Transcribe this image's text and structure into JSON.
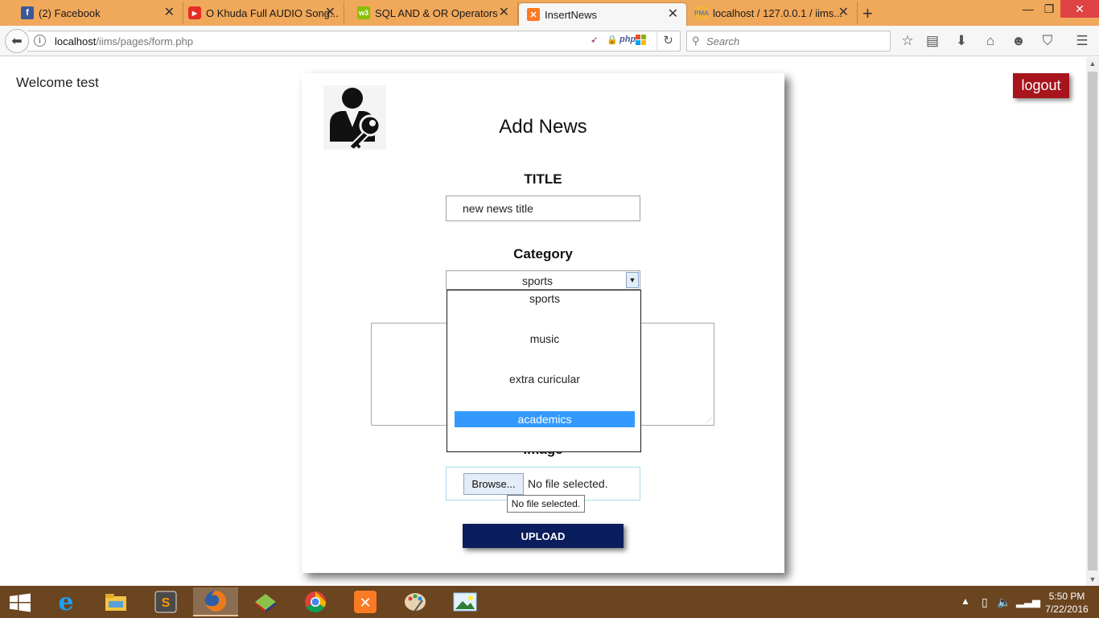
{
  "browser": {
    "tabs": [
      {
        "label": "(2) Facebook",
        "icon": "facebook-icon",
        "close": "✕"
      },
      {
        "label": "O Khuda Full AUDIO Song...",
        "icon": "youtube-icon",
        "close": "✕"
      },
      {
        "label": "SQL AND & OR Operators",
        "icon": "w3schools-icon",
        "close": "✕"
      },
      {
        "label": "InsertNews",
        "icon": "xampp-icon",
        "close": "✕",
        "active": true
      },
      {
        "label": "localhost / 127.0.0.1 / iims...",
        "icon": "phpmyadmin-icon",
        "close": "✕"
      }
    ],
    "new_tab": "+",
    "window_controls": {
      "minimize": "—",
      "maximize": "❐",
      "close": "✕"
    },
    "url": {
      "host": "localhost",
      "path": "/iims/pages/form.php"
    },
    "extension_php": "php",
    "search_placeholder": "Search"
  },
  "page": {
    "welcome": "Welcome test",
    "logout_label": "logout",
    "form": {
      "title": "Add News",
      "title_label": "TITLE",
      "title_value": "new news title",
      "category_label": "Category",
      "category_value": "sports",
      "category_options": [
        "sports",
        "music",
        "extra curicular",
        "academics"
      ],
      "highlighted_option": "academics",
      "image_label": "Image",
      "browse_label": "Browse...",
      "file_status": "No file selected.",
      "file_tooltip": "No file selected.",
      "upload_label": "UPLOAD"
    }
  },
  "taskbar": {
    "apps": [
      "internet-explorer-icon",
      "file-explorer-icon",
      "sublime-text-icon",
      "firefox-icon",
      "winrar-icon",
      "chrome-icon",
      "xampp-icon",
      "paint-icon",
      "photos-icon"
    ],
    "active_app": "firefox-icon",
    "clock_time": "5:50 PM",
    "clock_date": "7/22/2016"
  },
  "colors": {
    "tabstrip": "#f0a85a",
    "logout_bg": "#a8141c",
    "upload_bg": "#0a1d5c",
    "option_highlight": "#3399ff",
    "taskbar": "#6b4420"
  }
}
